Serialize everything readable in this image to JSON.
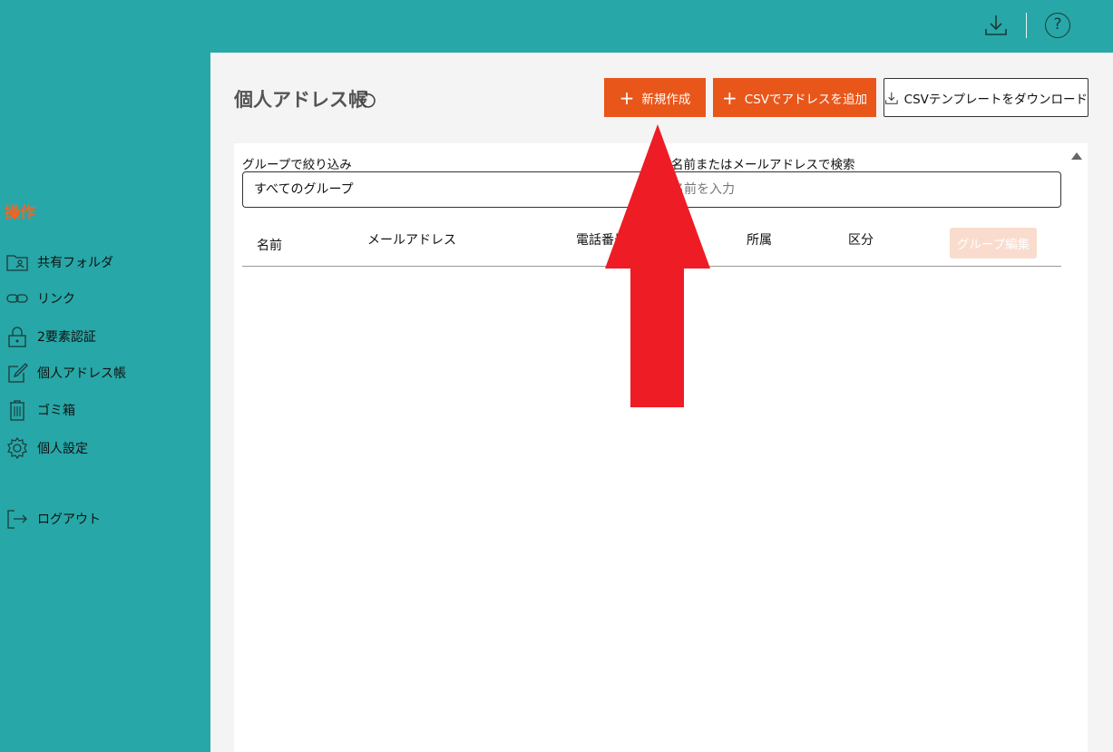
{
  "topbar": {
    "download_icon": "download-icon",
    "help_icon_glyph": "?"
  },
  "sidebar": {
    "section_title": "操作",
    "items": [
      {
        "label": "共有フォルダ",
        "icon": "shared-folder-icon"
      },
      {
        "label": "リンク",
        "icon": "link-icon"
      },
      {
        "label": "2要素認証",
        "icon": "lock-icon"
      },
      {
        "label": "個人アドレス帳",
        "icon": "edit-icon"
      },
      {
        "label": "ゴミ箱",
        "icon": "trash-icon"
      },
      {
        "label": "個人設定",
        "icon": "gear-icon"
      },
      {
        "label": "ログアウト",
        "icon": "logout-icon"
      }
    ]
  },
  "main": {
    "title": "個人アドレス帳",
    "buttons": {
      "new": "新規作成",
      "csv_add": "CSVでアドレスを追加",
      "csv_template": "CSVテンプレートをダウンロード",
      "plus_glyph": "+"
    },
    "filter": {
      "group_label": "グループで絞り込み",
      "group_value": "すべてのグループ",
      "search_label": "名前またはメールアドレスで検索",
      "search_placeholder": "名前を入力"
    },
    "table": {
      "columns": [
        "名前",
        "メールアドレス",
        "電話番号",
        "所属",
        "区分"
      ],
      "group_edit": "グループ編集",
      "rows": []
    }
  },
  "colors": {
    "teal": "#27a7a7",
    "orange": "#e8561a",
    "orange_disabled": "#f9dccd",
    "annotation_red": "#ee1c25"
  }
}
